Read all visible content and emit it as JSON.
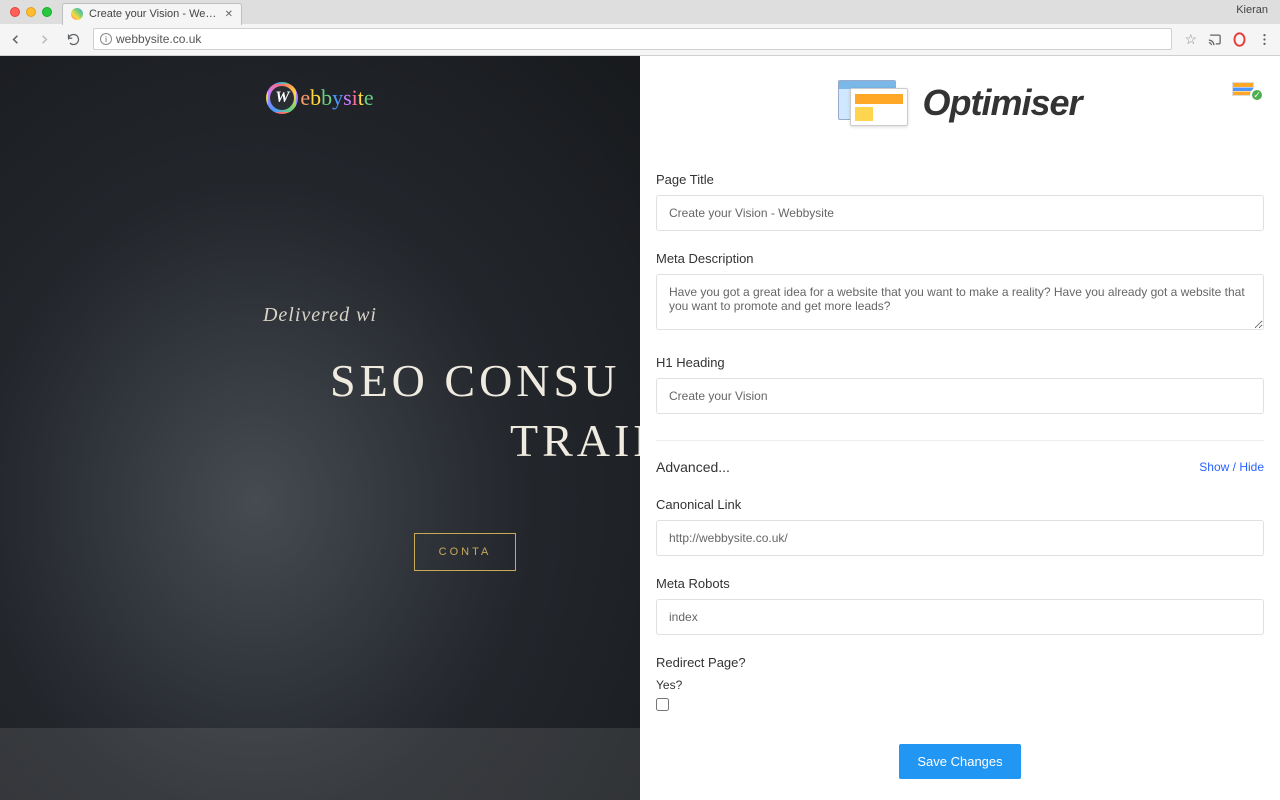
{
  "browser": {
    "tab_title": "Create your Vision - Webbysi",
    "profile_name": "Kieran",
    "url": "webbysite.co.uk"
  },
  "page_left": {
    "logo_text": "ebbysite",
    "hero_subtitle": "Delivered wi",
    "hero_line1": "SEO CONSU",
    "hero_line2": "TRAIN",
    "cta_label": "CONTA"
  },
  "panel": {
    "title": "Optimiser",
    "fields": {
      "page_title": {
        "label": "Page Title",
        "value": "Create your Vision - Webbysite"
      },
      "meta_description": {
        "label": "Meta Description",
        "value": "Have you got a great idea for a website that you want to make a reality? Have you already got a website that you want to promote and get more leads?"
      },
      "h1_heading": {
        "label": "H1 Heading",
        "value": "Create your Vision"
      },
      "advanced_label": "Advanced...",
      "show_hide": "Show / Hide",
      "canonical": {
        "label": "Canonical Link",
        "value": "http://webbysite.co.uk/"
      },
      "meta_robots": {
        "label": "Meta Robots",
        "value": "index"
      },
      "redirect": {
        "label": "Redirect Page?",
        "yes_label": "Yes?"
      },
      "save_button": "Save Changes"
    }
  }
}
